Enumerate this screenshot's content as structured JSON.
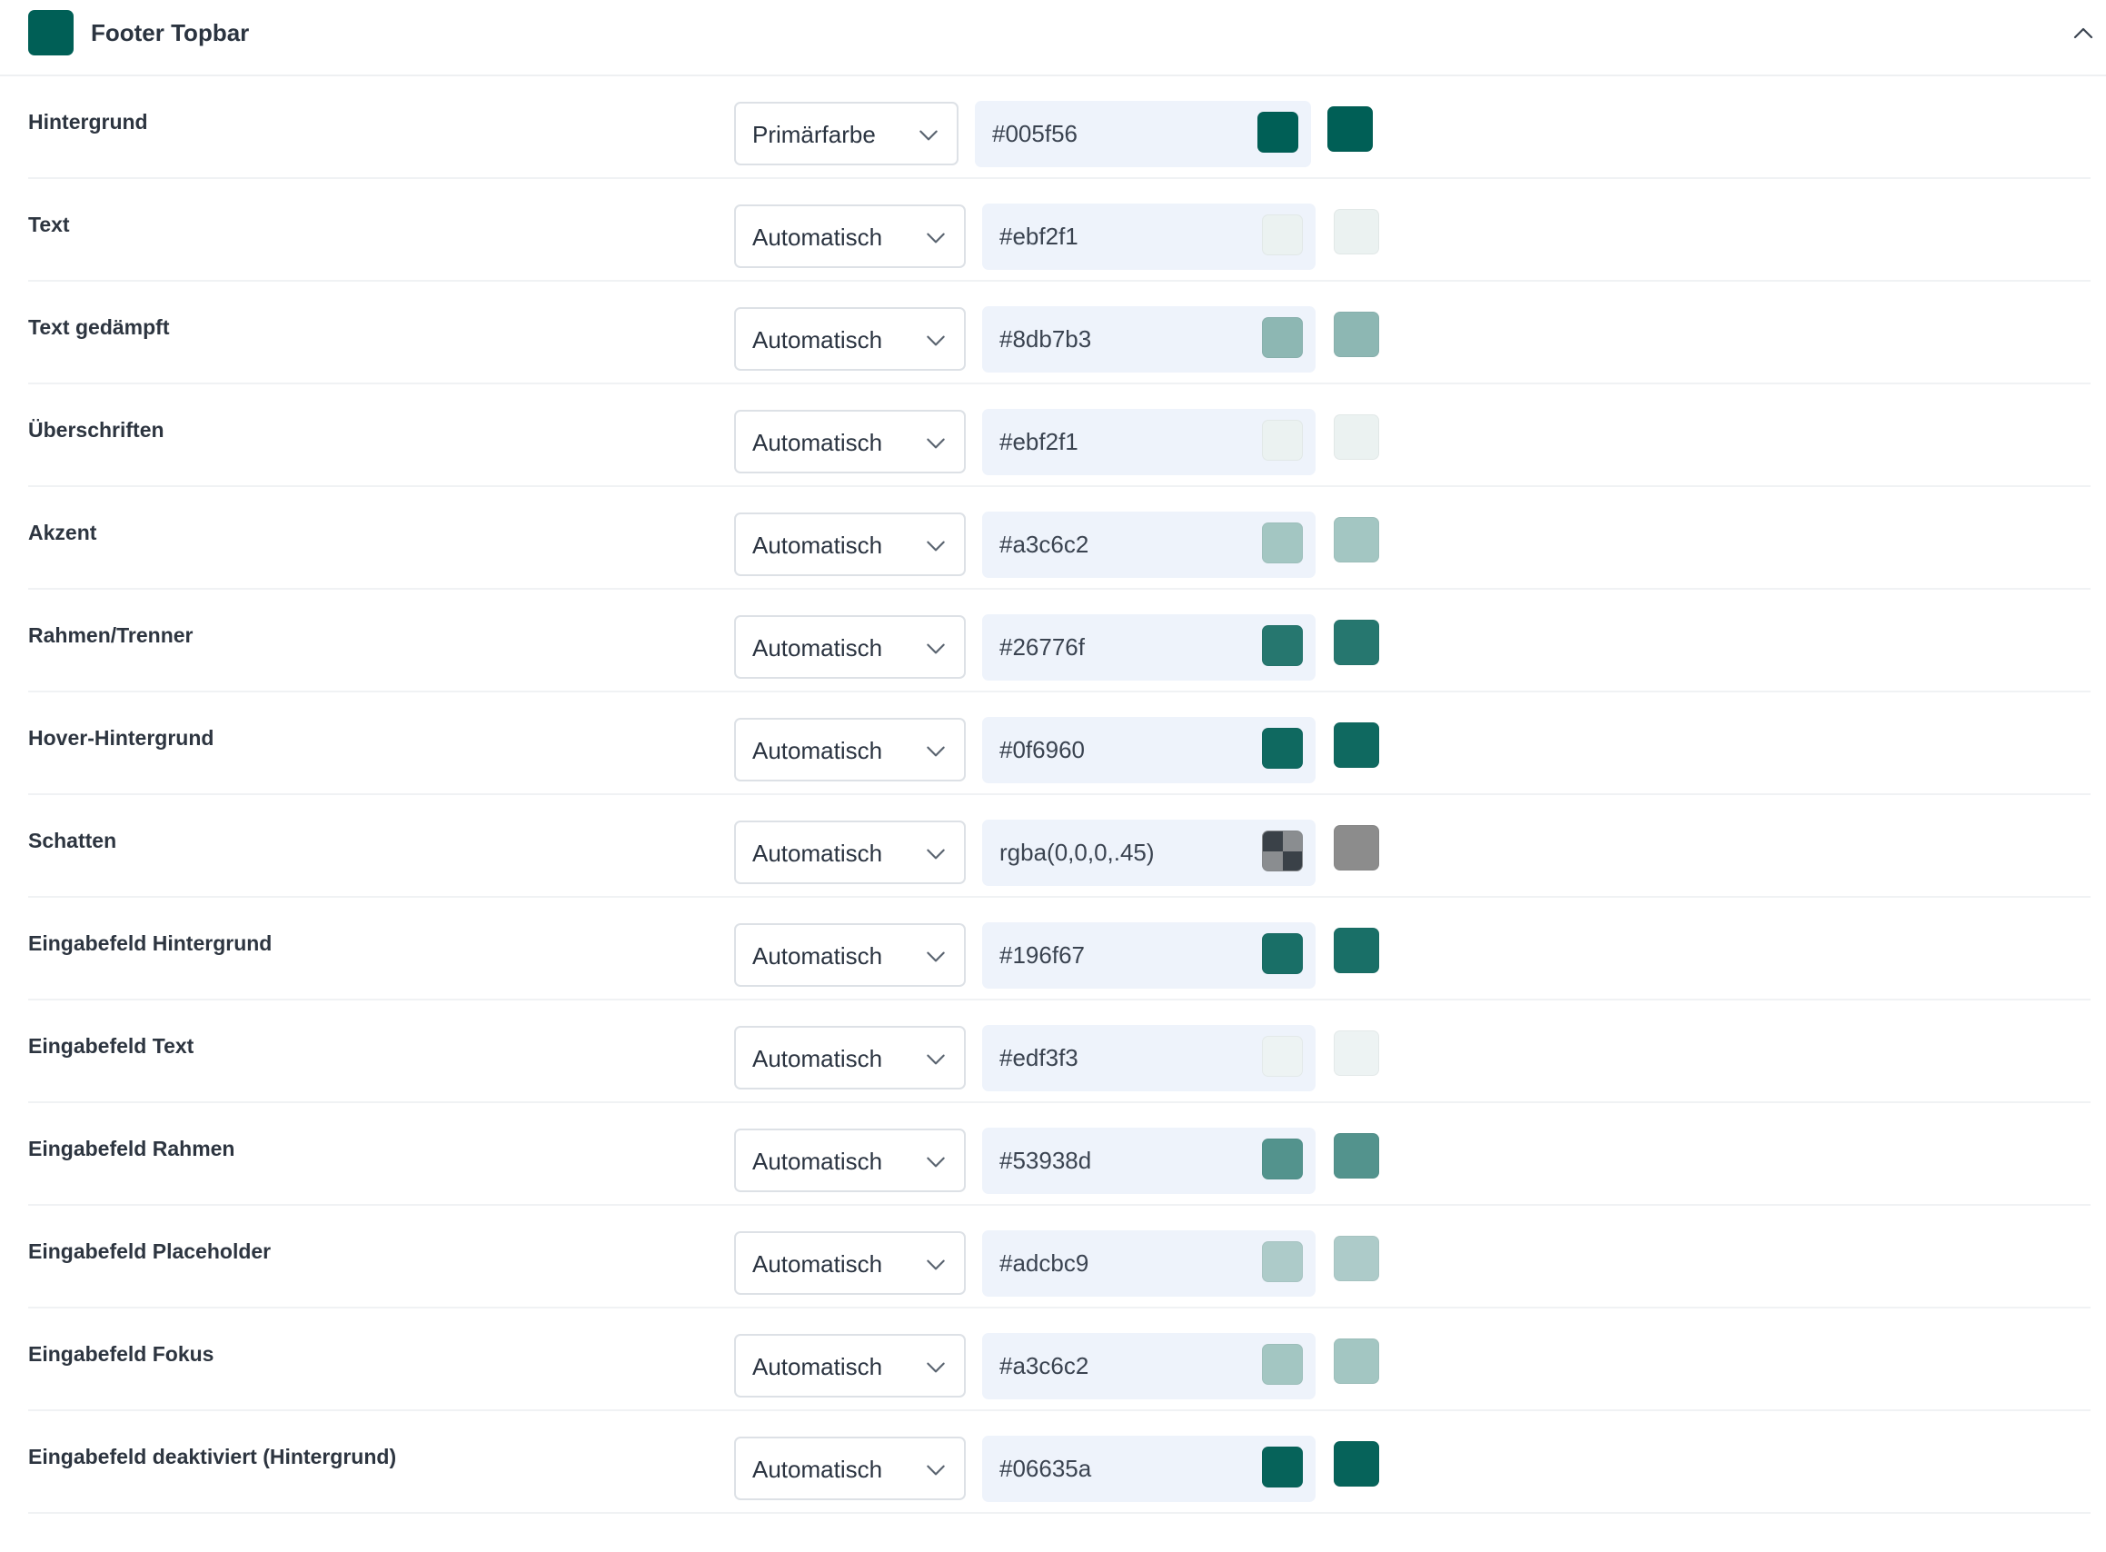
{
  "panel": {
    "title": "Footer Topbar",
    "swatch_color": "#005f56",
    "collapse_icon": "chevron-up-icon"
  },
  "rows": [
    {
      "label": "Hintergrund",
      "mode": "Primärfarbe",
      "value": "#005f56",
      "color": "#005f56"
    },
    {
      "label": "Text",
      "mode": "Automatisch",
      "value": "#ebf2f1",
      "color": "#ebf2f1"
    },
    {
      "label": "Text gedämpft",
      "mode": "Automatisch",
      "value": "#8db7b3",
      "color": "#8db7b3"
    },
    {
      "label": "Überschriften",
      "mode": "Automatisch",
      "value": "#ebf2f1",
      "color": "#ebf2f1"
    },
    {
      "label": "Akzent",
      "mode": "Automatisch",
      "value": "#a3c6c2",
      "color": "#a3c6c2"
    },
    {
      "label": "Rahmen/Trenner",
      "mode": "Automatisch",
      "value": "#26776f",
      "color": "#26776f"
    },
    {
      "label": "Hover-Hintergrund",
      "mode": "Automatisch",
      "value": "#0f6960",
      "color": "#0f6960"
    },
    {
      "label": "Schatten",
      "mode": "Automatisch",
      "value": "rgba(0,0,0,.45)",
      "color": "#8c8c8c",
      "checker": true
    },
    {
      "label": "Eingabefeld Hintergrund",
      "mode": "Automatisch",
      "value": "#196f67",
      "color": "#196f67"
    },
    {
      "label": "Eingabefeld Text",
      "mode": "Automatisch",
      "value": "#edf3f3",
      "color": "#edf3f3"
    },
    {
      "label": "Eingabefeld Rahmen",
      "mode": "Automatisch",
      "value": "#53938d",
      "color": "#53938d"
    },
    {
      "label": "Eingabefeld Placeholder",
      "mode": "Automatisch",
      "value": "#adcbc9",
      "color": "#adcbc9"
    },
    {
      "label": "Eingabefeld Fokus",
      "mode": "Automatisch",
      "value": "#a3c6c2",
      "color": "#a3c6c2"
    },
    {
      "label": "Eingabefeld deaktiviert (Hintergrund)",
      "mode": "Automatisch",
      "value": "#06635a",
      "color": "#06635a"
    }
  ]
}
